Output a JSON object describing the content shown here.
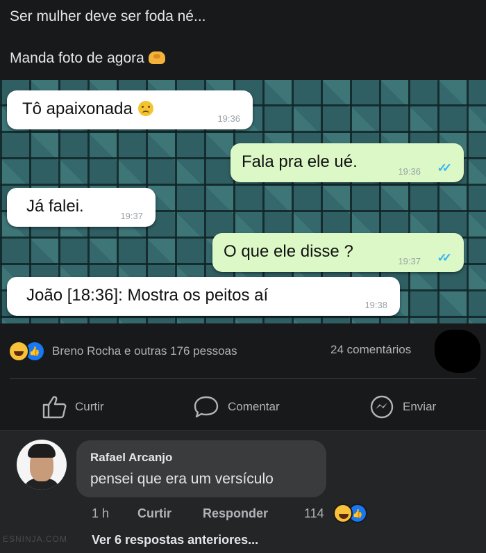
{
  "post": {
    "line1": "Ser mulher deve ser foda né...",
    "line2": "Manda foto de agora"
  },
  "chat": {
    "messages": [
      {
        "text": "Tô apaixonada",
        "time": "19:36"
      },
      {
        "text": "Fala pra ele ué.",
        "time": "19:36"
      },
      {
        "text": "Já falei.",
        "time": "19:37"
      },
      {
        "text": "O que ele disse ?",
        "time": "19:37"
      },
      {
        "text": "João [18:36]: Mostra os peitos aí",
        "time": "19:38"
      }
    ]
  },
  "reactions": {
    "text": "Breno Rocha e outras 176 pessoas",
    "comments": "24 comentários"
  },
  "actions": {
    "like": "Curtir",
    "comment": "Comentar",
    "send": "Enviar"
  },
  "comment": {
    "author": "Rafael Arcanjo",
    "text": "pensei que era um versículo",
    "time": "1 h",
    "like": "Curtir",
    "reply": "Responder",
    "reaction_count": "114",
    "view_replies": "Ver 6 respostas anteriores..."
  },
  "watermark": "ESNINJA.COM",
  "icons": [
    "handshake-emoji",
    "sad-emoji",
    "double-check-icon",
    "haha-reaction-icon",
    "like-reaction-icon",
    "thumbs-up-icon",
    "comment-icon",
    "messenger-icon"
  ],
  "colors": {
    "background": "#18191a",
    "incoming_bubble": "#ffffff",
    "outgoing_bubble": "#dcf8c6",
    "read_ticks": "#34b7f1",
    "like_blue": "#1877f2"
  }
}
